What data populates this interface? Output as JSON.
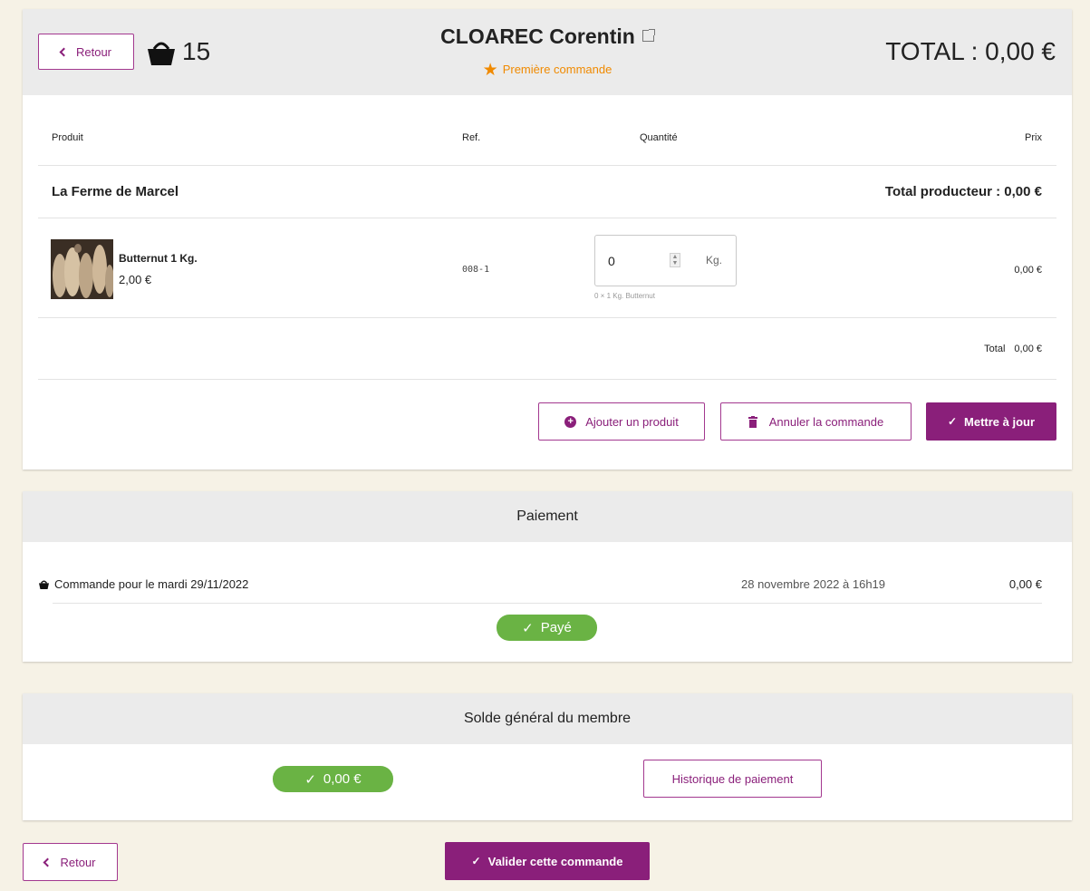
{
  "order": {
    "back_label": "Retour",
    "basket_count": "15",
    "customer_name": "CLOAREC Corentin",
    "first_order_label": "Première commande",
    "total_label": "TOTAL : 0,00 €",
    "columns": {
      "product": "Produit",
      "ref": "Ref.",
      "quantity": "Quantité",
      "price": "Prix"
    },
    "producer": {
      "name": "La Ferme de Marcel",
      "total_label": "Total producteur : 0,00 €"
    },
    "line": {
      "name": "Butternut 1 Kg.",
      "unit_price": "2,00 €",
      "ref": "008-1",
      "quantity": "0",
      "unit": "Kg.",
      "hint": "0 × 1 Kg. Butternut",
      "price": "0,00 €"
    },
    "subtotal": {
      "label": "Total",
      "value": "0,00 €"
    },
    "add_product_label": "Ajouter un produit",
    "cancel_label": "Annuler la commande",
    "update_label": "Mettre à jour"
  },
  "payment": {
    "title": "Paiement",
    "description": "Commande pour le mardi 29/11/2022",
    "date": "28 novembre 2022 à 16h19",
    "amount": "0,00 €",
    "status": "Payé"
  },
  "balance": {
    "title": "Solde général du membre",
    "amount": "0,00 €",
    "history_label": "Historique de paiement"
  },
  "footer": {
    "back_label": "Retour",
    "validate_label": "Valider cette commande"
  },
  "colors": {
    "brand": "#8a1f7a",
    "accent_orange": "#f08a00",
    "paid_green": "#6ab344",
    "page_bg": "#f6f2e6",
    "header_bg": "#ebebeb"
  }
}
